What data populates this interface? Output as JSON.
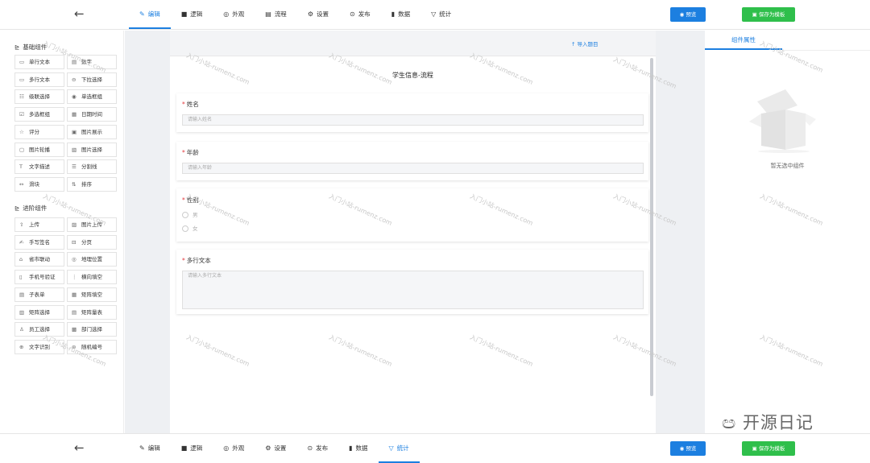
{
  "header": {
    "back_icon": "←",
    "tabs": [
      {
        "icon": "✎",
        "label": "编辑"
      },
      {
        "icon": "■",
        "label": "逻辑"
      },
      {
        "icon": "◎",
        "label": "外观"
      },
      {
        "icon": "▤",
        "label": "流程"
      },
      {
        "icon": "⚙",
        "label": "设置"
      },
      {
        "icon": "⊙",
        "label": "发布"
      },
      {
        "icon": "▮",
        "label": "数据"
      },
      {
        "icon": "▽",
        "label": "统计"
      }
    ],
    "active_tab_top": "编辑",
    "preview_label": "预览",
    "save_template_label": "保存为模板"
  },
  "footer_bar": {
    "tabs": [
      {
        "icon": "✎",
        "label": "编辑"
      },
      {
        "icon": "■",
        "label": "逻辑"
      },
      {
        "icon": "◎",
        "label": "外观"
      },
      {
        "icon": "⚙",
        "label": "设置"
      },
      {
        "icon": "⊙",
        "label": "发布"
      },
      {
        "icon": "▮",
        "label": "数据"
      },
      {
        "icon": "▽",
        "label": "统计"
      }
    ],
    "active_tab": "统计",
    "preview_label": "预览",
    "save_template_label": "保存为模板"
  },
  "sidebar": {
    "basic_title": "基础组件",
    "basic_items": [
      {
        "icon": "▭",
        "label": "单行文本"
      },
      {
        "icon": "▤",
        "label": "数字"
      },
      {
        "icon": "▭",
        "label": "多行文本"
      },
      {
        "icon": "⊖",
        "label": "下拉选择"
      },
      {
        "icon": "☷",
        "label": "级联选择"
      },
      {
        "icon": "◉",
        "label": "单选框组"
      },
      {
        "icon": "☑",
        "label": "多选框组"
      },
      {
        "icon": "▦",
        "label": "日期时间"
      },
      {
        "icon": "☆",
        "label": "评分"
      },
      {
        "icon": "▣",
        "label": "图片展示"
      },
      {
        "icon": "▢",
        "label": "图片轮播"
      },
      {
        "icon": "▧",
        "label": "图片选择"
      },
      {
        "icon": "T",
        "label": "文字描述"
      },
      {
        "icon": "☰",
        "label": "分割线"
      },
      {
        "icon": "↔",
        "label": "滑块"
      },
      {
        "icon": "⇅",
        "label": "排序"
      }
    ],
    "advanced_title": "进阶组件",
    "advanced_items": [
      {
        "icon": "⇧",
        "label": "上传"
      },
      {
        "icon": "▨",
        "label": "图片上传"
      },
      {
        "icon": "✍",
        "label": "手写签名"
      },
      {
        "icon": "⊟",
        "label": "分页"
      },
      {
        "icon": "⌂",
        "label": "省市联动"
      },
      {
        "icon": "◎",
        "label": "地理位置"
      },
      {
        "icon": "▯",
        "label": "手机号验证"
      },
      {
        "icon": "⋮",
        "label": "横向填空"
      },
      {
        "icon": "▤",
        "label": "子表单"
      },
      {
        "icon": "▦",
        "label": "矩阵填空"
      },
      {
        "icon": "▥",
        "label": "矩阵选择"
      },
      {
        "icon": "▤",
        "label": "矩阵量表"
      },
      {
        "icon": "♙",
        "label": "员工选择"
      },
      {
        "icon": "▩",
        "label": "部门选择"
      },
      {
        "icon": "⊕",
        "label": "文字识别"
      },
      {
        "icon": "⊜",
        "label": "随机编号"
      }
    ]
  },
  "form": {
    "import_label": "导入题目",
    "import_icon": "↑",
    "title": "学生信息-流程",
    "fields": [
      {
        "label": "姓名",
        "placeholder": "请输入姓名"
      },
      {
        "label": "年龄",
        "placeholder": "请输入年龄"
      },
      {
        "label": "性别",
        "options": [
          "男",
          "女"
        ]
      },
      {
        "label": "多行文本",
        "placeholder": "请输入多行文本"
      }
    ]
  },
  "right_panel": {
    "tab_label": "组件属性",
    "empty_text": "暂无选中组件"
  },
  "watermark_text": "入门小站-rumenz.com",
  "logo_text": "开源日记"
}
